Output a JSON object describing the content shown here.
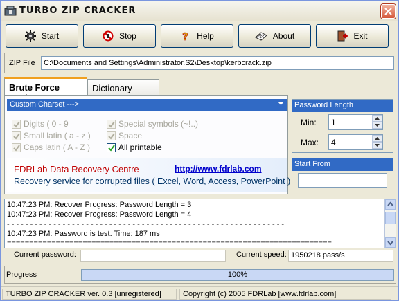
{
  "window": {
    "title": "TURBO ZIP CRACKER"
  },
  "toolbar": [
    {
      "label": "Start",
      "icon": "gear-icon"
    },
    {
      "label": "Stop",
      "icon": "stop-icon"
    },
    {
      "label": "Help",
      "icon": "question-icon"
    },
    {
      "label": "About",
      "icon": "about-icon"
    },
    {
      "label": "Exit",
      "icon": "exit-icon"
    }
  ],
  "zip": {
    "label": "ZIP File",
    "path": "C:\\Documents and Settings\\Administrator.S2\\Desktop\\kerbcrack.zip"
  },
  "tabs": [
    {
      "label": "Brute Force Mode",
      "active": true
    },
    {
      "label": "Dictionary Mode",
      "active": false
    }
  ],
  "brute": {
    "charset": "Custom Charset   --->",
    "checkboxes": [
      {
        "label": "Digits  ( 0 - 9",
        "checked": true,
        "enabled": false
      },
      {
        "label": "Small latin  ( a - z )",
        "checked": true,
        "enabled": false
      },
      {
        "label": "Caps latin  ( A - Z )",
        "checked": true,
        "enabled": false
      },
      {
        "label": "Special symbols  (~!..)",
        "checked": true,
        "enabled": false
      },
      {
        "label": "Space",
        "checked": true,
        "enabled": false
      },
      {
        "label": "All printable",
        "checked": true,
        "enabled": true
      }
    ],
    "promo": {
      "title": "FDRLab Data Recovery Centre",
      "link": "http://www.fdrlab.com",
      "desc": "Recovery service for corrupted files ( Excel, Word, Access, PowerPoint )"
    }
  },
  "password_length": {
    "header": "Password Length",
    "min_label": "Min:",
    "min": "1",
    "max_label": "Max:",
    "max": "4"
  },
  "start_from": {
    "header": "Start From",
    "value": ""
  },
  "log": [
    "10:47:23 PM: Recover Progress: Password Length = 3",
    "10:47:23 PM: Recover Progress: Password Length = 4",
    "- - - - - - - - - - - - - - - - - - - - - - - - - - - - - - - - - - - - - - - - - - - - - - - - - - - - - - - - - - - -",
    "10:47:23 PM: Password is test. Time: 187 ms",
    "========================================================================="
  ],
  "current": {
    "password_label": "Current password:",
    "password": "",
    "speed_label": "Current speed:",
    "speed": "1950218 pass/s"
  },
  "progress": {
    "label": "Progress",
    "fraction": 1.0,
    "text": "100%"
  },
  "status": {
    "left": "TURBO ZIP CRACKER ver. 0.3 [unregistered]",
    "right": "Copyright (c) 2005 FDRLab [www.fdrlab.com]"
  },
  "colors": {
    "accent": "#316ac5",
    "window_bg": "#ece9d8",
    "promo_title": "#c00000",
    "link": "#0000cc"
  }
}
